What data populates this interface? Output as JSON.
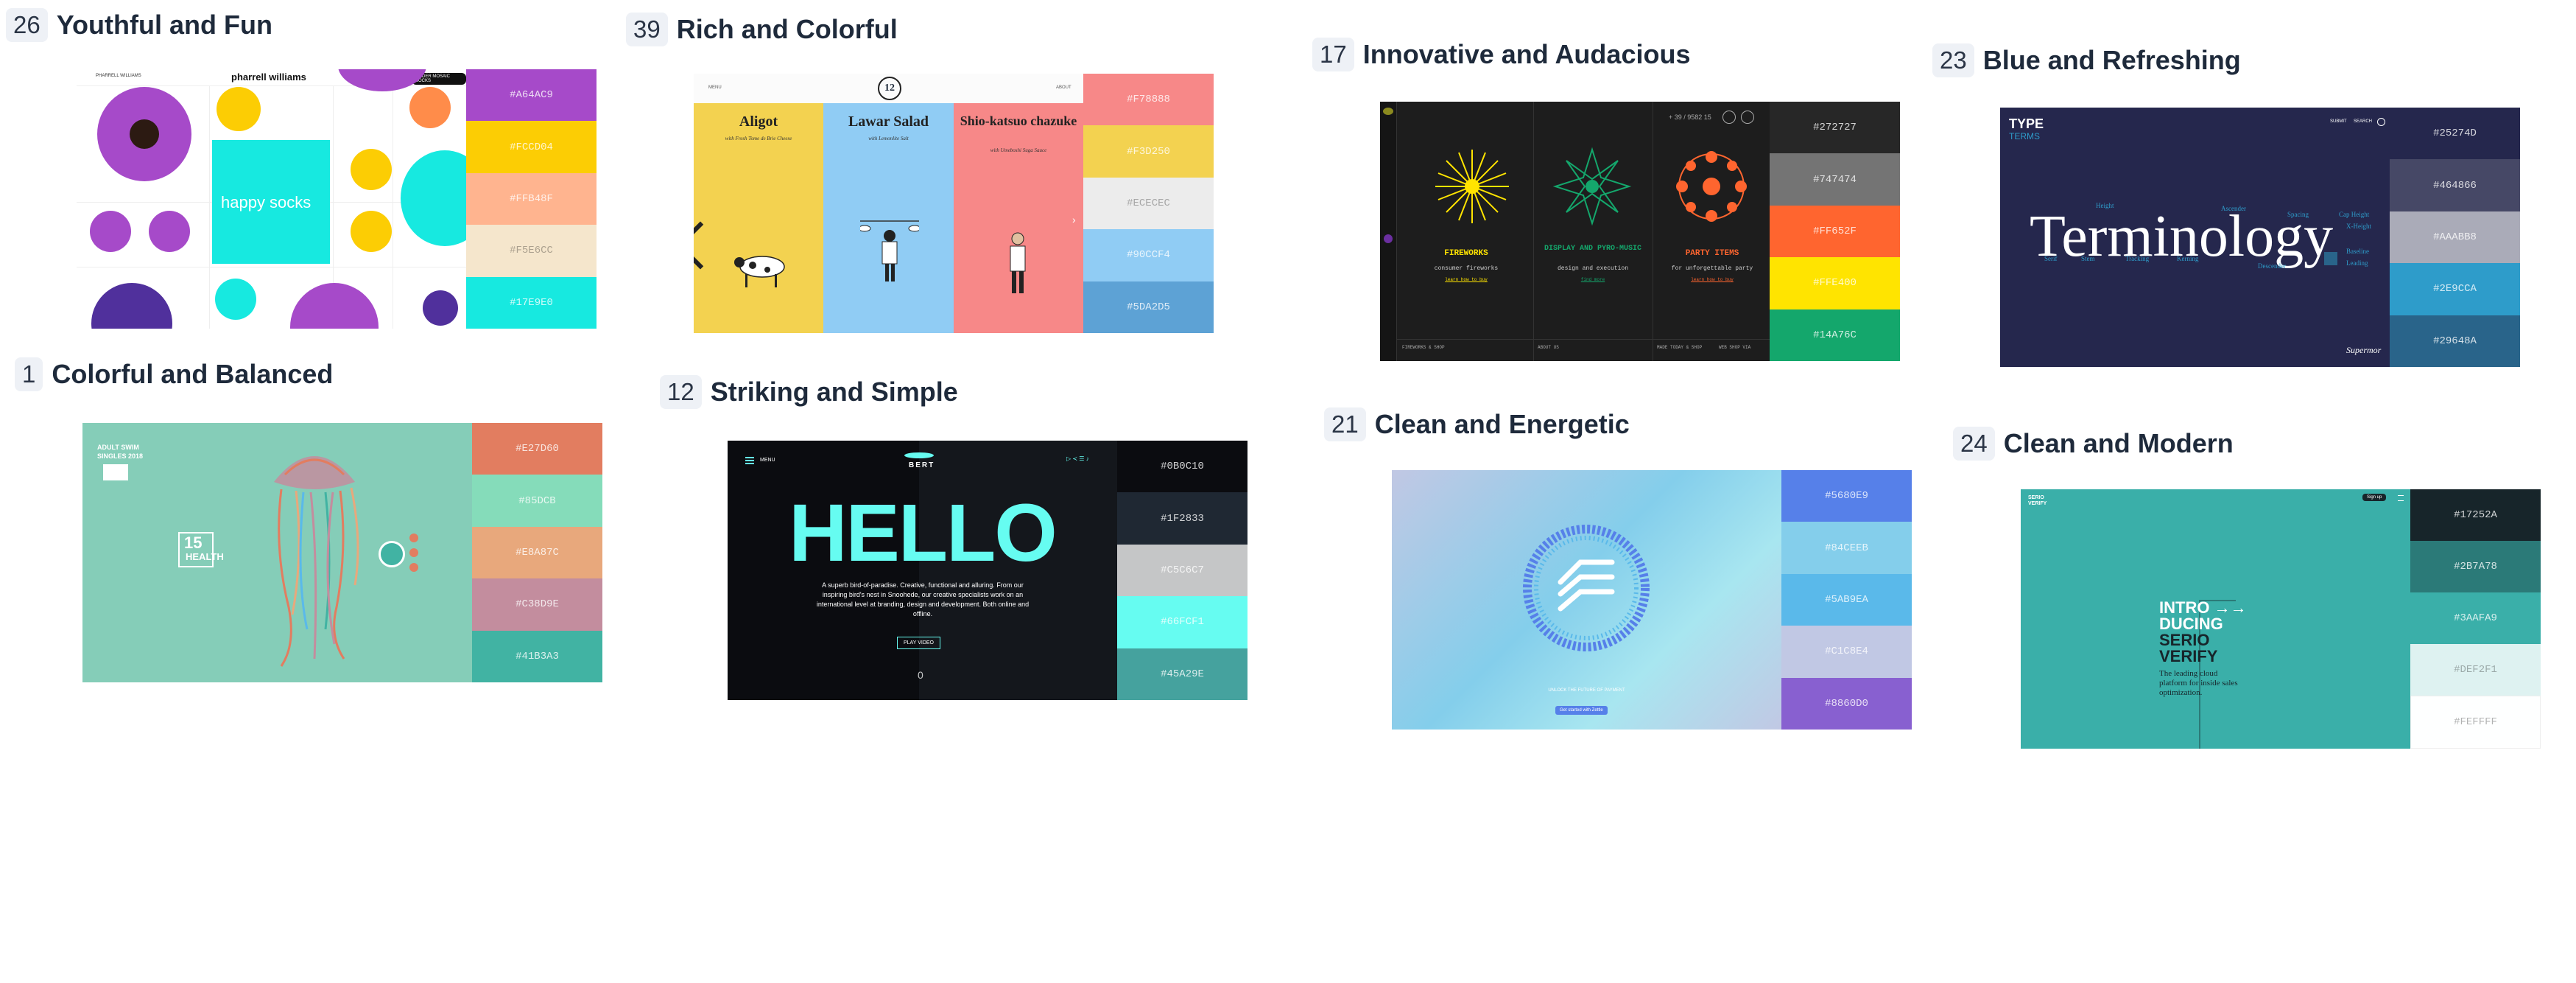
{
  "cards": [
    {
      "number": "26",
      "title": "Youthful and Fun",
      "palette": [
        "#A64AC9",
        "#FCCD04",
        "#FFB48F",
        "#F5E6CC",
        "#17E9E0"
      ],
      "screenshot": {
        "brand": "pharrell williams",
        "headline": "happy socks",
        "nav_left": "PHARRELL WILLIAMS",
        "nav_right": "ORDER MOSAIC SOCKS"
      }
    },
    {
      "number": "39",
      "title": "Rich and Colorful",
      "palette": [
        "#F78888",
        "#F3D250",
        "#ECECEC",
        "#90CCF4",
        "#5DA2D5"
      ],
      "screenshot": {
        "logo": "12",
        "nav_left": "MENU",
        "nav_right": "ABOUT",
        "dishes": [
          {
            "name": "Aligot",
            "subtitle": "with Fresh Tome de Brie Cheese"
          },
          {
            "name": "Lawar Salad",
            "subtitle": "with Lemonlite Salt"
          },
          {
            "name": "Shio-katsuo chazuke",
            "subtitle": "with Umeboshi Suga Sauce"
          }
        ]
      }
    },
    {
      "number": "17",
      "title": "Innovative and Audacious",
      "palette": [
        "#272727",
        "#747474",
        "#FF652F",
        "#FFE400",
        "#14A76C"
      ],
      "screenshot": {
        "phone": "+ 39 / 9582 15",
        "panels": [
          {
            "title": "FIREWORKS",
            "desc": "consumer fireworks",
            "link": "learn how to buy"
          },
          {
            "title": "DISPLAY AND PYRO-MUSIC",
            "desc": "design and execution",
            "link": "find more"
          },
          {
            "title": "PARTY ITEMS",
            "desc": "for unforgettable party",
            "link": "learn how to buy"
          }
        ],
        "footer": [
          "FIREWORKS & SHOP",
          "ABOUT US",
          "MADE TODAY & SHOP",
          "WEB SHOP VIA"
        ]
      }
    },
    {
      "number": "23",
      "title": "Blue and Refreshing",
      "palette": [
        "#25274D",
        "#464866",
        "#AAABB8",
        "#2E9CCA",
        "#29648A"
      ],
      "screenshot": {
        "logo_top": "TYPE",
        "logo_bottom": "TERMS",
        "headline": "Terminology",
        "nav": [
          "SUBMIT",
          "SEARCH"
        ],
        "signature": "Supermor",
        "words": [
          "Height",
          "Ascender",
          "Cap Height",
          "X-Height",
          "Serif",
          "Baseline",
          "Leading",
          "Stem",
          "Descender",
          "Kerning",
          "Tracking",
          "Spacing"
        ]
      }
    },
    {
      "number": "1",
      "title": "Colorful and Balanced",
      "palette": [
        "#E27D60",
        "#85DCB",
        "#E8A87C",
        "#C38D9E",
        "#41B3A3"
      ],
      "screenshot": {
        "corner_text": [
          "ADULT SWIM",
          "SINGLES 2018"
        ],
        "badge": "15",
        "badge_word": "HEALTH"
      }
    },
    {
      "number": "12",
      "title": "Striking and Simple",
      "palette": [
        "#0B0C10",
        "#1F2833",
        "#C5C6C7",
        "#66FCF1",
        "#45A29E"
      ],
      "screenshot": {
        "brand": "BERT",
        "menu": "MENU",
        "headline": "HELLO",
        "body": "A superb bird-of-paradise. Creative, functional and alluring. From our inspiring bird's nest in Snoohede, our creative specialists work on an international level at branding, design and development. Both online and offline.",
        "button": "PLAY VIDEO",
        "counter": "0"
      }
    },
    {
      "number": "21",
      "title": "Clean and Energetic",
      "palette": [
        "#5680E9",
        "#84CEEB",
        "#5AB9EA",
        "#C1C8E4",
        "#8860D0"
      ],
      "screenshot": {
        "tagline": "UNLOCK THE FUTURE OF PAYMENT",
        "button": "Get started with Zettle"
      }
    },
    {
      "number": "24",
      "title": "Clean and Modern",
      "palette": [
        "#17252A",
        "#2B7A78",
        "#3AAFA9",
        "#DEF2F1",
        "#FEFFFF"
      ],
      "screenshot": {
        "logo": "SERIO VERIFY",
        "nav_button": "Sign up",
        "headline": [
          "INTRO →→",
          "DUCING",
          "SERIO",
          "VERIFY"
        ],
        "body": "The leading cloud platform for inside sales optimization."
      }
    }
  ]
}
